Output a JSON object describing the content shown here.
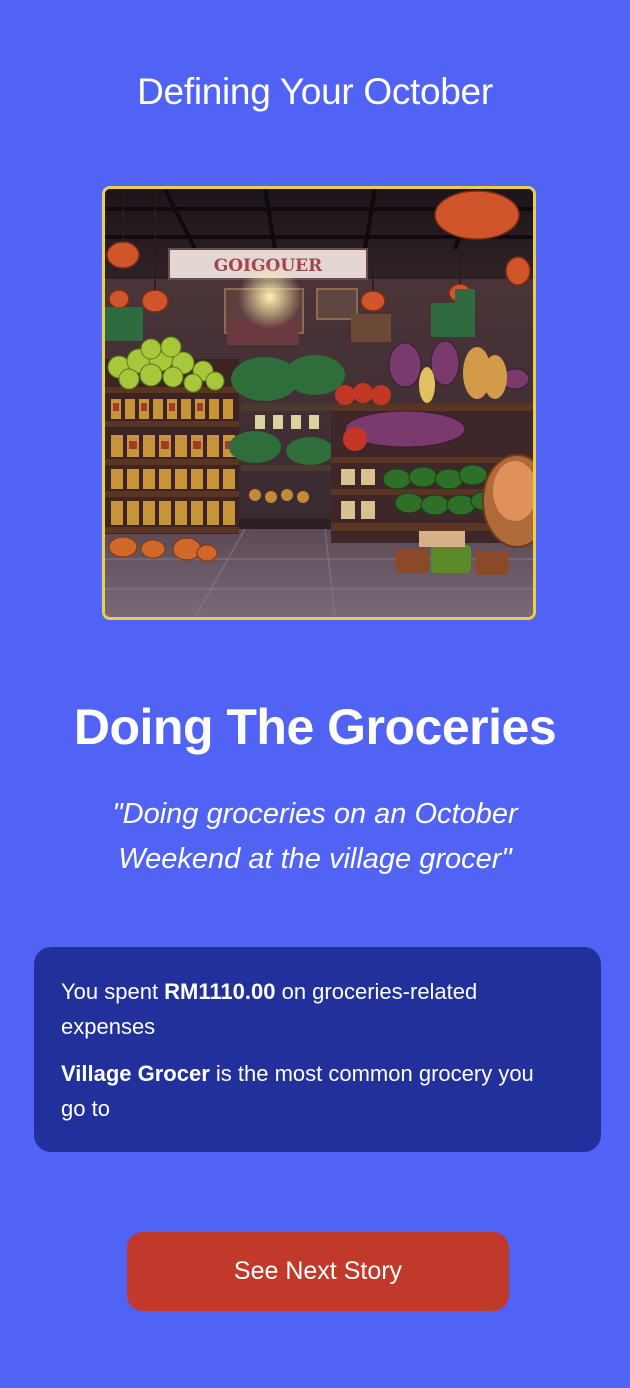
{
  "header": {
    "title": "Defining Your October"
  },
  "story": {
    "image": {
      "sign_text": "GOIGOUER"
    },
    "title": "Doing The Groceries",
    "quote": "\"Doing groceries on an October Weekend at the village grocer\""
  },
  "summary": {
    "spent_prefix": "You spent ",
    "spent_amount": "RM1110.00",
    "spent_suffix": " on groceries-related expenses",
    "store_name": "Village Grocer",
    "store_suffix": " is the most common grocery you go to"
  },
  "actions": {
    "next_label": "See Next Story"
  },
  "colors": {
    "background": "#5163f5",
    "card": "#22309b",
    "button": "#c0392b",
    "image_border": "#e8d04a"
  }
}
